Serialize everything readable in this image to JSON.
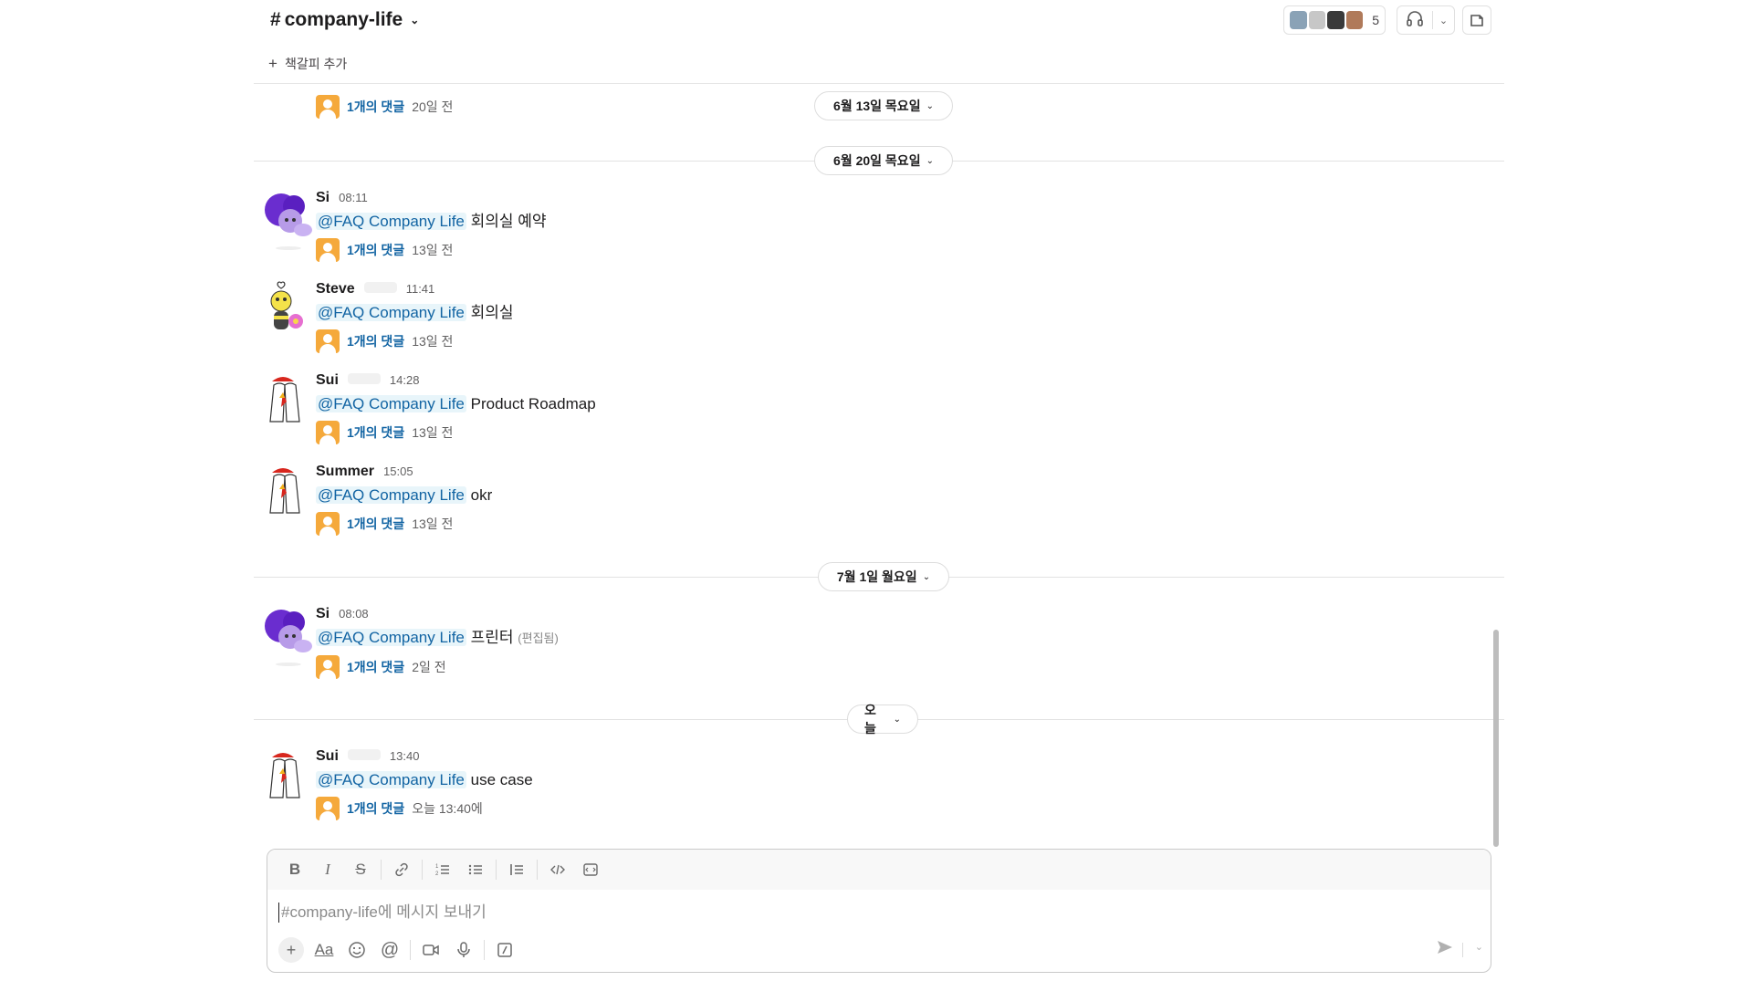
{
  "header": {
    "channel_hash": "#",
    "channel_name": "company-life",
    "bookmark_label": "책갈피 추가",
    "member_count": "5"
  },
  "partial_message": {
    "reply_count": "1개의 댓글",
    "reply_time": "20일 전"
  },
  "dates": {
    "d1": "6월 13일 목요일",
    "d2": "6월 20일 목요일",
    "d3": "7월 1일 월요일",
    "d4": "오늘"
  },
  "messages": [
    {
      "user": "Si",
      "time": "08:11",
      "mention": "@FAQ Company Life",
      "text": "회의실 예약",
      "reply_count": "1개의 댓글",
      "reply_time": "13일 전"
    },
    {
      "user": "Steve",
      "time": "11:41",
      "mention": "@FAQ Company Life",
      "text": "회의실",
      "reply_count": "1개의 댓글",
      "reply_time": "13일 전"
    },
    {
      "user": "Sui",
      "time": "14:28",
      "mention": "@FAQ Company Life",
      "text": "Product Roadmap",
      "reply_count": "1개의 댓글",
      "reply_time": "13일 전"
    },
    {
      "user": "Summer",
      "time": "15:05",
      "mention": "@FAQ Company Life",
      "text": "okr",
      "reply_count": "1개의 댓글",
      "reply_time": "13일 전"
    },
    {
      "user": "Si",
      "time": "08:08",
      "mention": "@FAQ Company Life",
      "text": "프린터",
      "edited": "(편집됨)",
      "reply_count": "1개의 댓글",
      "reply_time": "2일 전"
    },
    {
      "user": "Sui",
      "time": "13:40",
      "mention": "@FAQ Company Life",
      "text": "use case",
      "reply_count": "1개의 댓글",
      "reply_time": "오늘 13:40에"
    }
  ],
  "composer": {
    "placeholder": "#company-life에 메시지 보내기"
  },
  "colors": {
    "link": "#1264a3",
    "mention_bg": "#e8f5fa",
    "thread_avatar": "#f5a93b"
  }
}
